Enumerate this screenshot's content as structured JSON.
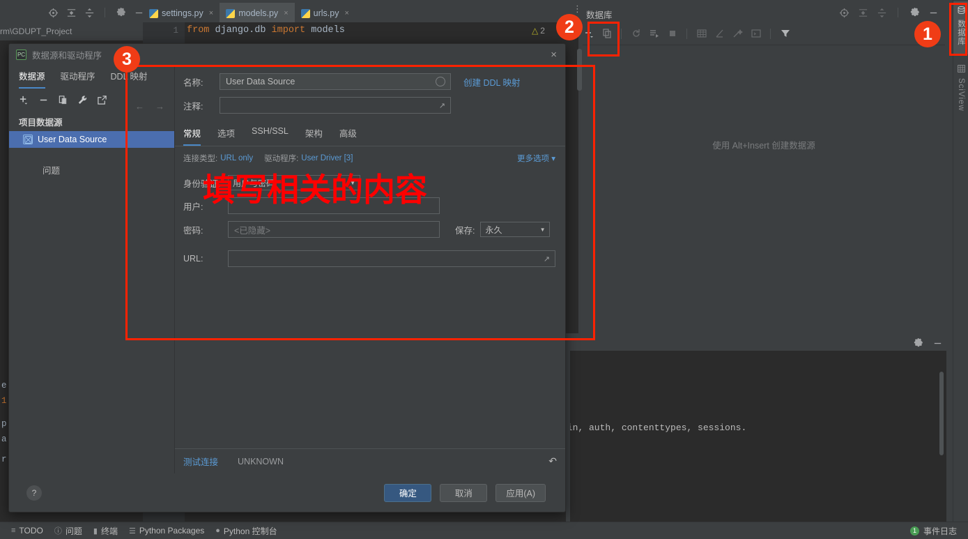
{
  "ide": {
    "project_path": "rm\\GDUPT_Project",
    "toolbar_icons": [
      "locate-icon",
      "collapse-all-icon",
      "expand-all-icon",
      "settings-gear-icon",
      "minimize-icon"
    ],
    "tabs": [
      {
        "label": "settings.py",
        "active": false
      },
      {
        "label": "models.py",
        "active": true
      },
      {
        "label": "urls.py",
        "active": false
      }
    ],
    "editor": {
      "line_number": "1",
      "code_keyword1": "from",
      "code_mid": " django.db ",
      "code_keyword2": "import",
      "code_tail": " models",
      "warning_count": "2"
    }
  },
  "db_panel": {
    "title": "数据库",
    "title_icons": [
      "locate-icon",
      "collapse-all-icon",
      "expand-all-icon",
      "settings-gear-icon",
      "minimize-icon"
    ],
    "toolbar_icons": [
      "add-icon",
      "duplicate-icon",
      "refresh-icon",
      "run-sql-icon",
      "stop-icon",
      "table-icon",
      "diagram-icon",
      "jump-to-icon",
      "console-icon",
      "filter-icon"
    ],
    "empty_hint": "使用 Alt+Insert 创建数据源"
  },
  "vertical_tabs": [
    {
      "label": "数据库",
      "icon": "database-icon",
      "selected": true
    },
    {
      "label": "SciView",
      "icon": "grid-icon",
      "selected": false
    }
  ],
  "console": {
    "icons": [
      "settings-gear-icon",
      "minimize-icon"
    ],
    "output_line": "min, auth, contenttypes, sessions."
  },
  "statusbar": {
    "items": [
      {
        "label": "TODO",
        "icon": "todo-icon"
      },
      {
        "label": "问题",
        "icon": "problems-icon"
      },
      {
        "label": "终端",
        "icon": "terminal-icon"
      },
      {
        "label": "Python Packages",
        "icon": "packages-icon"
      },
      {
        "label": "Python 控制台",
        "icon": "python-console-icon"
      }
    ],
    "event_log": {
      "label": "事件日志",
      "count": "1"
    }
  },
  "dialog": {
    "title": "数据源和驱动程序",
    "app_icon": "PC",
    "close_icon": "×",
    "tabs": [
      {
        "label": "数据源",
        "active": true
      },
      {
        "label": "驱动程序",
        "active": false
      },
      {
        "label": "DDL 映射",
        "active": false
      }
    ],
    "toolbar_icons": [
      "add-icon",
      "remove-icon",
      "copy-icon",
      "wrench-icon",
      "export-icon"
    ],
    "nav_icons": [
      "back-arrow-icon",
      "forward-arrow-icon"
    ],
    "tree": {
      "group_label": "项目数据源",
      "selected_item": "User Data Source",
      "item_icon": "datasource-icon",
      "issues_label": "问题"
    },
    "form": {
      "name_label": "名称:",
      "name_value": "User Data Source",
      "ddl_link": "创建 DDL 映射",
      "comment_label": "注释:",
      "comment_value": "",
      "subtabs": [
        {
          "label": "常规",
          "active": true
        },
        {
          "label": "选项",
          "active": false
        },
        {
          "label": "SSH/SSL",
          "active": false
        },
        {
          "label": "架构",
          "active": false
        },
        {
          "label": "高级",
          "active": false
        }
      ],
      "conn_type_label": "连接类型:",
      "conn_type_value": "URL only",
      "driver_label": "驱动程序:",
      "driver_value": "User Driver [3]",
      "more_options": "更多选项",
      "auth_label": "身份验证:",
      "auth_value": "用户与密码",
      "user_label": "用户:",
      "user_value": "",
      "password_label": "密码:",
      "password_placeholder": "<已隐藏>",
      "save_label": "保存:",
      "save_value": "永久",
      "url_label": "URL:",
      "url_value": ""
    },
    "status": {
      "test_connection": "测试连接",
      "state": "UNKNOWN",
      "revert_icon": "revert-icon"
    },
    "footer": {
      "help": "?",
      "ok": "确定",
      "cancel": "取消",
      "apply": "应用(A)"
    }
  },
  "annotations": {
    "badge1": "1",
    "badge2": "2",
    "badge3": "3",
    "note": "填写相关的内容",
    "color": "#ff2200"
  }
}
